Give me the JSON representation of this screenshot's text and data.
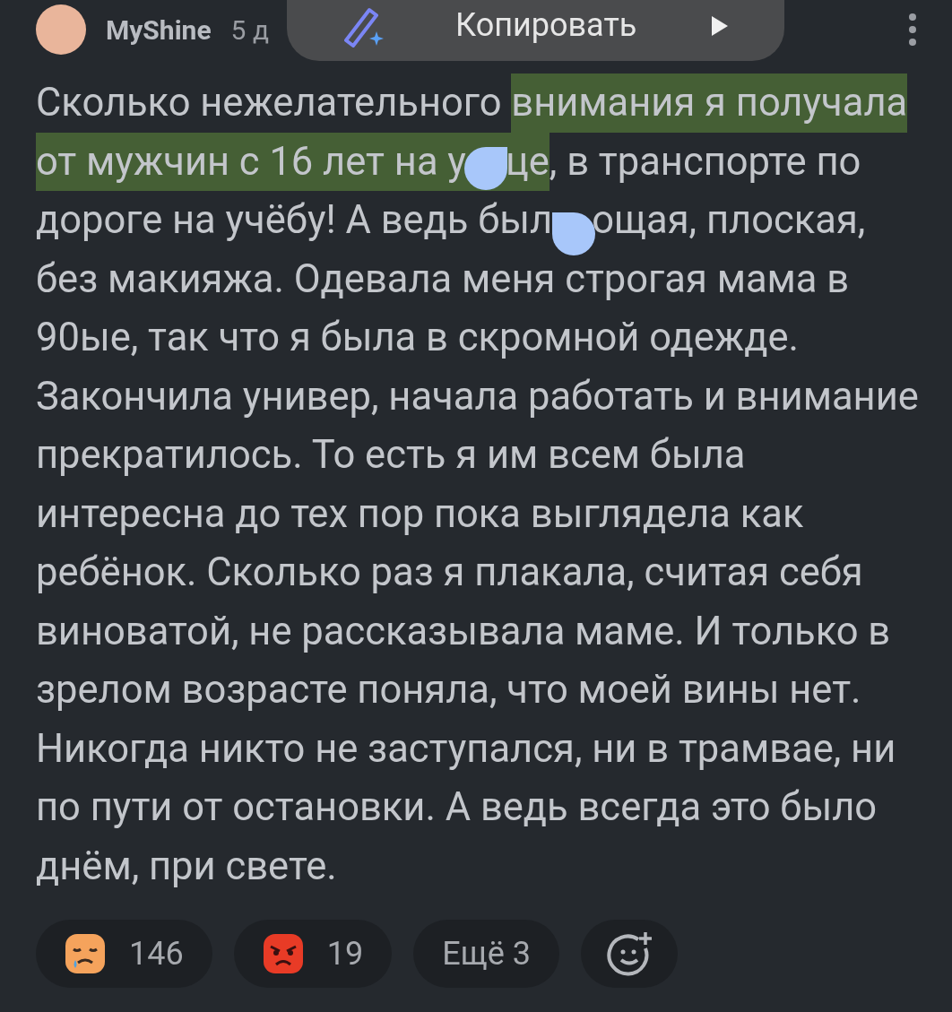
{
  "comment": {
    "author": "MyShine",
    "time": "5 д",
    "lines": [
      [
        {
          "text": "Сколько нежелательного ",
          "selected": false
        },
        {
          "text": "внимания я получала",
          "selected": true
        }
      ],
      [
        {
          "text": "от мужчин с 16 лет на у",
          "selected": true
        },
        {
          "kind": "handle",
          "selected": true
        },
        {
          "text": "це",
          "selected": true
        },
        {
          "text": ", в транспорте по",
          "selected": false
        }
      ],
      [
        {
          "text": "дороге на учёбу! А ведь был",
          "selected": false
        },
        {
          "kind": "handle",
          "selected": false
        },
        {
          "text": "ощая, плоская,",
          "selected": false
        }
      ],
      [
        {
          "text": "без макияжа. Одевала меня строгая мама в",
          "selected": false
        }
      ],
      [
        {
          "text": "90ые, так что я была в скромной одежде.",
          "selected": false
        }
      ],
      [
        {
          "text": "Закончила универ, начала работать и внимание",
          "selected": false
        }
      ],
      [
        {
          "text": "прекратилось. То есть я им всем была",
          "selected": false
        }
      ],
      [
        {
          "text": "интересна до тех пор пока выглядела как",
          "selected": false
        }
      ],
      [
        {
          "text": "ребёнок. Сколько раз я плакала, считая себя",
          "selected": false
        }
      ],
      [
        {
          "text": "виноватой, не рассказывала маме. И только в",
          "selected": false
        }
      ],
      [
        {
          "text": "зрелом возрасте поняла, что моей вины нет.",
          "selected": false
        }
      ],
      [
        {
          "text": "Никогда никто не заступался, ни в трамвае, ни",
          "selected": false
        }
      ],
      [
        {
          "text": "по пути от остановки. А ведь всегда это было",
          "selected": false
        }
      ],
      [
        {
          "text": "днём, при свете.",
          "selected": false
        }
      ]
    ]
  },
  "selection_menu": {
    "label": "Копировать"
  },
  "reactions": [
    {
      "kind": "sad",
      "count": "146"
    },
    {
      "kind": "angry",
      "count": "19"
    },
    {
      "kind": "more",
      "label": "Ещё 3"
    },
    {
      "kind": "add"
    }
  ]
}
